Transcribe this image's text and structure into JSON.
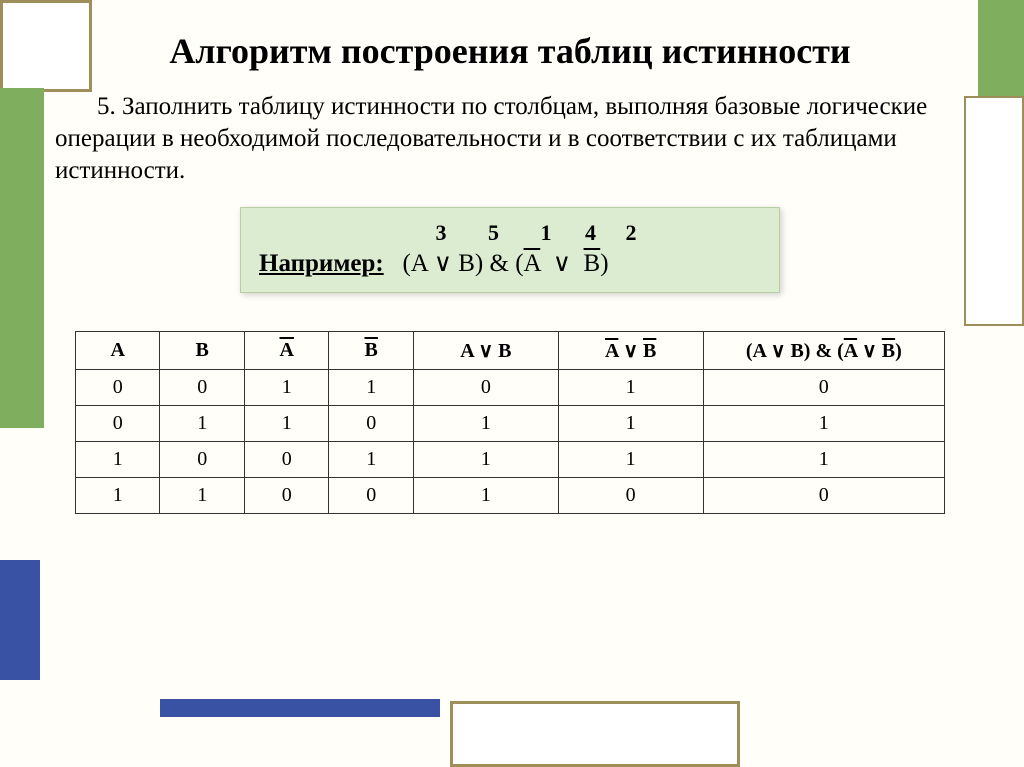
{
  "title": "Алгоритм построения таблиц истинности",
  "body": "5. Заполнить таблицу истинности по столбцам, выполняя базовые логические операции в необходимой последовательности и в соответствии с их таблицами истинности.",
  "example": {
    "label": "Например:",
    "order": [
      "3",
      "5",
      "1",
      "4",
      "2"
    ],
    "expr_parts": {
      "open1": "(A ∨ B)",
      "amp": "&",
      "open2": "(",
      "notA": "A",
      "or": "∨",
      "notB": "B",
      "close2": ")"
    }
  },
  "table": {
    "headers": {
      "A": "A",
      "B": "B",
      "notA": "A",
      "notB": "B",
      "AorB": "A ∨ B",
      "notAornotB_A": "A",
      "notAornotB_mid": " ∨ ",
      "notAornotB_B": "B",
      "final_left": "(A ∨ B) & (",
      "final_A": "A",
      "final_mid": "  ∨  ",
      "final_B": "B",
      "final_right": ")"
    },
    "rows": [
      {
        "A": "0",
        "B": "0",
        "nA": "1",
        "nB": "1",
        "AorB": "0",
        "nAonB": "1",
        "res": "0"
      },
      {
        "A": "0",
        "B": "1",
        "nA": "1",
        "nB": "0",
        "AorB": "1",
        "nAonB": "1",
        "res": "1"
      },
      {
        "A": "1",
        "B": "0",
        "nA": "0",
        "nB": "1",
        "AorB": "1",
        "nAonB": "1",
        "res": "1"
      },
      {
        "A": "1",
        "B": "1",
        "nA": "0",
        "nB": "0",
        "AorB": "1",
        "nAonB": "0",
        "res": "0"
      }
    ]
  },
  "chart_data": {
    "type": "table",
    "title": "Truth table for (A ∨ B) & (¬A ∨ ¬B)",
    "columns": [
      "A",
      "B",
      "¬A",
      "¬B",
      "A ∨ B",
      "¬A ∨ ¬B",
      "(A ∨ B) & (¬A ∨ ¬B)"
    ],
    "rows": [
      [
        0,
        0,
        1,
        1,
        0,
        1,
        0
      ],
      [
        0,
        1,
        1,
        0,
        1,
        1,
        1
      ],
      [
        1,
        0,
        0,
        1,
        1,
        1,
        1
      ],
      [
        1,
        1,
        0,
        0,
        1,
        0,
        0
      ]
    ],
    "operation_order": {
      "A∨B": 3,
      "&": 5,
      "¬A": 1,
      "∨(inner)": 4,
      "¬B": 2
    }
  }
}
